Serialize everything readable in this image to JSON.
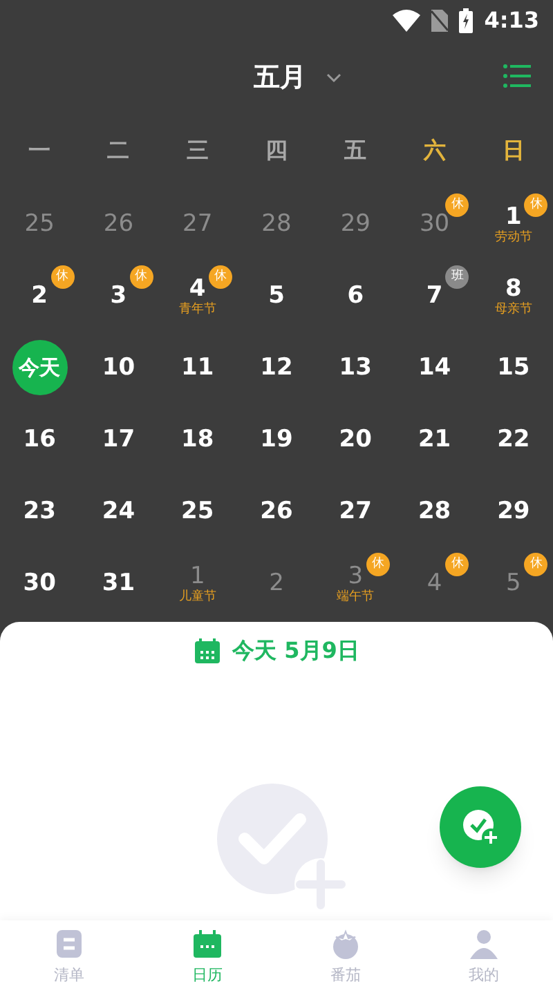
{
  "status_bar": {
    "time": "4:13"
  },
  "header": {
    "month": "五月"
  },
  "weekdays": [
    {
      "label": "一",
      "weekend": false
    },
    {
      "label": "二",
      "weekend": false
    },
    {
      "label": "三",
      "weekend": false
    },
    {
      "label": "四",
      "weekend": false
    },
    {
      "label": "五",
      "weekend": false
    },
    {
      "label": "六",
      "weekend": true
    },
    {
      "label": "日",
      "weekend": true
    }
  ],
  "weeks": [
    [
      {
        "day": "25",
        "muted": true
      },
      {
        "day": "26",
        "muted": true
      },
      {
        "day": "27",
        "muted": true
      },
      {
        "day": "28",
        "muted": true
      },
      {
        "day": "29",
        "muted": true
      },
      {
        "day": "30",
        "muted": true,
        "badge": {
          "text": "休",
          "kind": "rest"
        }
      },
      {
        "day": "1",
        "muted": false,
        "badge": {
          "text": "休",
          "kind": "rest"
        },
        "festival": "劳动节"
      }
    ],
    [
      {
        "day": "2",
        "muted": false,
        "badge": {
          "text": "休",
          "kind": "rest"
        }
      },
      {
        "day": "3",
        "muted": false,
        "badge": {
          "text": "休",
          "kind": "rest"
        }
      },
      {
        "day": "4",
        "muted": false,
        "badge": {
          "text": "休",
          "kind": "rest"
        },
        "festival": "青年节"
      },
      {
        "day": "5",
        "muted": false
      },
      {
        "day": "6",
        "muted": false
      },
      {
        "day": "7",
        "muted": false,
        "badge": {
          "text": "班",
          "kind": "work"
        }
      },
      {
        "day": "8",
        "muted": false,
        "festival": "母亲节"
      }
    ],
    [
      {
        "day": "今天",
        "selected": true
      },
      {
        "day": "10",
        "muted": false
      },
      {
        "day": "11",
        "muted": false
      },
      {
        "day": "12",
        "muted": false
      },
      {
        "day": "13",
        "muted": false
      },
      {
        "day": "14",
        "muted": false
      },
      {
        "day": "15",
        "muted": false
      }
    ],
    [
      {
        "day": "16",
        "muted": false
      },
      {
        "day": "17",
        "muted": false
      },
      {
        "day": "18",
        "muted": false
      },
      {
        "day": "19",
        "muted": false
      },
      {
        "day": "20",
        "muted": false
      },
      {
        "day": "21",
        "muted": false
      },
      {
        "day": "22",
        "muted": false
      }
    ],
    [
      {
        "day": "23",
        "muted": false
      },
      {
        "day": "24",
        "muted": false
      },
      {
        "day": "25",
        "muted": false
      },
      {
        "day": "26",
        "muted": false
      },
      {
        "day": "27",
        "muted": false
      },
      {
        "day": "28",
        "muted": false
      },
      {
        "day": "29",
        "muted": false
      }
    ],
    [
      {
        "day": "30",
        "muted": false
      },
      {
        "day": "31",
        "muted": false
      },
      {
        "day": "1",
        "muted": true,
        "festival": "儿童节"
      },
      {
        "day": "2",
        "muted": true
      },
      {
        "day": "3",
        "muted": true,
        "badge": {
          "text": "休",
          "kind": "rest"
        },
        "festival": "端午节"
      },
      {
        "day": "4",
        "muted": true,
        "badge": {
          "text": "休",
          "kind": "rest"
        }
      },
      {
        "day": "5",
        "muted": true,
        "badge": {
          "text": "休",
          "kind": "rest"
        }
      }
    ]
  ],
  "sheet": {
    "title": "今天 5月9日"
  },
  "nav": [
    {
      "label": "清单",
      "selected": false
    },
    {
      "label": "日历",
      "selected": true
    },
    {
      "label": "番茄",
      "selected": false
    },
    {
      "label": "我的",
      "selected": false
    }
  ]
}
